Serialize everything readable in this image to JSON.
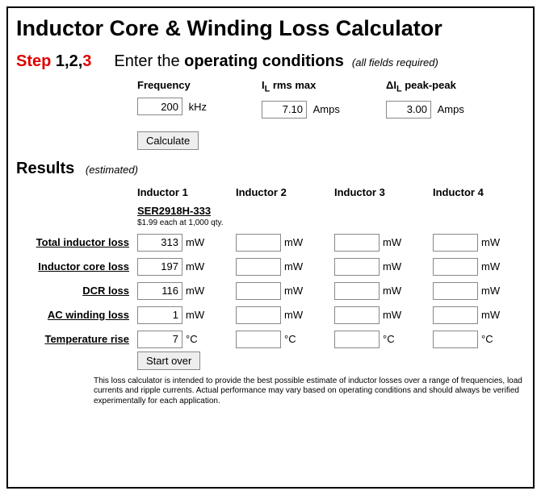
{
  "title": "Inductor Core & Winding Loss Calculator",
  "step": {
    "prefix": "Step",
    "parts": [
      " 1,",
      "2,",
      "3"
    ]
  },
  "enter": {
    "pre": "Enter the ",
    "strong": "operating conditions",
    "note": "(all fields required)"
  },
  "conditions": {
    "freq": {
      "label": "Frequency",
      "value": "200",
      "unit": "kHz"
    },
    "il": {
      "label_pre": "I",
      "label_sub": "L",
      "label_post": " rms max",
      "value": "7.10",
      "unit": "Amps"
    },
    "dil": {
      "label_pre": "ΔI",
      "label_sub": "L",
      "label_post": " peak-peak",
      "value": "3.00",
      "unit": "Amps"
    }
  },
  "buttons": {
    "calculate": "Calculate",
    "start_over": "Start over"
  },
  "results": {
    "heading": "Results",
    "estimated": "(estimated)"
  },
  "columns": [
    "Inductor 1",
    "Inductor 2",
    "Inductor 3",
    "Inductor 4"
  ],
  "inductors": [
    {
      "part": "SER2918H-333",
      "price": "$1.99 each at 1,000 qty."
    },
    {
      "part": "",
      "price": ""
    },
    {
      "part": "",
      "price": ""
    },
    {
      "part": "",
      "price": ""
    }
  ],
  "rows": [
    {
      "label": "Total inductor loss",
      "unit": "mW",
      "vals": [
        "313",
        "",
        "",
        ""
      ]
    },
    {
      "label": "Inductor core loss",
      "unit": "mW",
      "vals": [
        "197",
        "",
        "",
        ""
      ]
    },
    {
      "label": "DCR loss",
      "unit": "mW",
      "vals": [
        "116",
        "",
        "",
        ""
      ]
    },
    {
      "label": "AC winding loss",
      "unit": "mW",
      "vals": [
        "1",
        "",
        "",
        ""
      ]
    },
    {
      "label": "Temperature rise",
      "unit": "°C",
      "vals": [
        "7",
        "",
        "",
        ""
      ]
    }
  ],
  "disclaimer": "This loss calculator is intended to provide the best possible estimate of inductor losses over a range of frequencies, load currents and ripple currents. Actual performance may vary based on operating conditions and should always be verified experimentally for each application."
}
